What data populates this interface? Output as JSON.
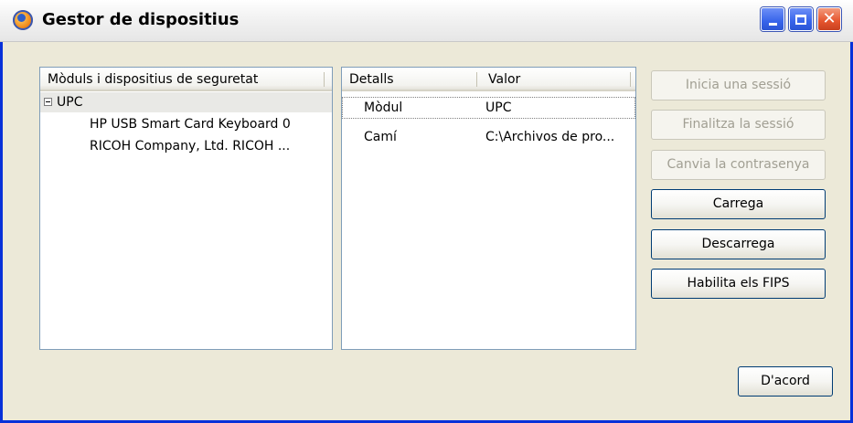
{
  "window": {
    "title": "Gestor de dispositius",
    "controls": {
      "minimize_icon": "minimize-icon",
      "maximize_icon": "maximize-icon",
      "close_icon": "close-icon"
    }
  },
  "modules_list": {
    "header": "Mòduls i dispositius de seguretat",
    "items": [
      {
        "label": "UPC",
        "expanded": true,
        "expander_icon": "tree-collapse-icon"
      },
      {
        "label": "HP USB Smart Card Keyboard 0"
      },
      {
        "label": "RICOH Company, Ltd. RICOH ..."
      }
    ]
  },
  "details_table": {
    "columns": [
      "Detalls",
      "Valor"
    ],
    "rows": [
      {
        "key": "Mòdul",
        "value": "UPC"
      },
      {
        "key": "Camí",
        "value": "C:\\Archivos de pro..."
      }
    ]
  },
  "actions": {
    "login": "Inicia una sessió",
    "logout": "Finalitza la sessió",
    "change_password": "Canvia la contrasenya",
    "load": "Carrega",
    "unload": "Descarrega",
    "enable_fips": "Habilita els FIPS",
    "ok": "D'acord"
  },
  "colors": {
    "title_bar_button": "#3764ea",
    "close_button": "#e5542d",
    "dialog_background": "#ece9d8",
    "button_border": "#003c74"
  }
}
